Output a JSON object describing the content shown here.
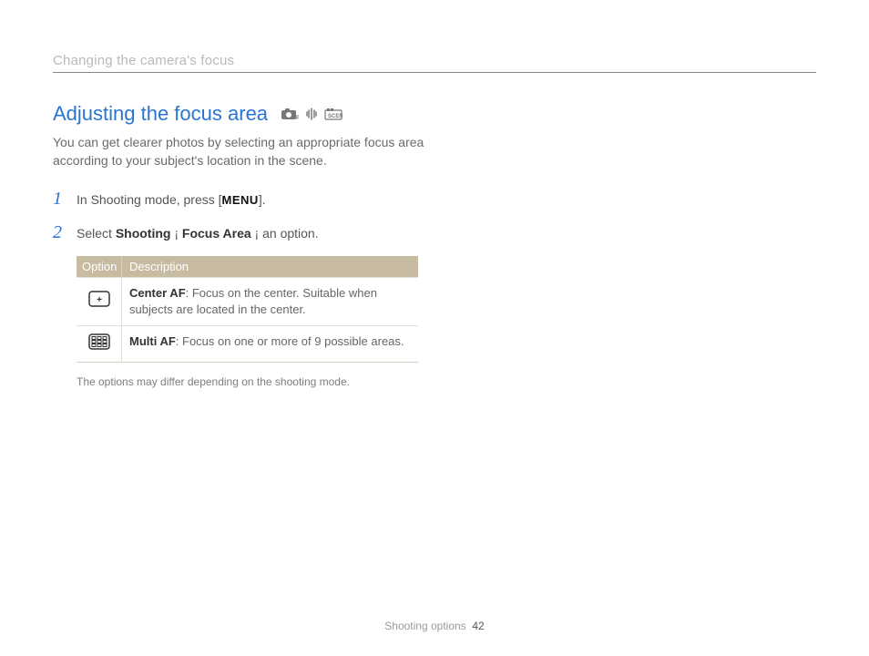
{
  "topbar": {
    "title": "Changing the camera's focus"
  },
  "heading": "Adjusting the focus area",
  "mode_icons": [
    "camera-p-icon",
    "dual-is-icon",
    "scene-icon"
  ],
  "intro": "You can get clearer photos by selecting an appropriate focus area according to your subject's location in the scene.",
  "steps": [
    {
      "num": "1",
      "prefix": "In Shooting mode, press [",
      "strong": "MENU",
      "suffix": "]."
    },
    {
      "num": "2",
      "prefix": "Select ",
      "strong1": "Shooting",
      "arrow1": " ¡ ",
      "strong2": "Focus Area",
      "arrow2": " ¡ ",
      "suffix": "an option."
    }
  ],
  "table": {
    "head_option": "Option",
    "head_description": "Description",
    "rows": [
      {
        "icon": "center-af-icon",
        "name": "Center AF",
        "desc": ": Focus on the center. Suitable when subjects are located in the center."
      },
      {
        "icon": "multi-af-icon",
        "name": "Multi AF",
        "desc": ": Focus on one or more of 9 possible areas."
      }
    ]
  },
  "note": "The options may differ depending on the shooting mode.",
  "footer": {
    "section": "Shooting options",
    "page": "42"
  }
}
